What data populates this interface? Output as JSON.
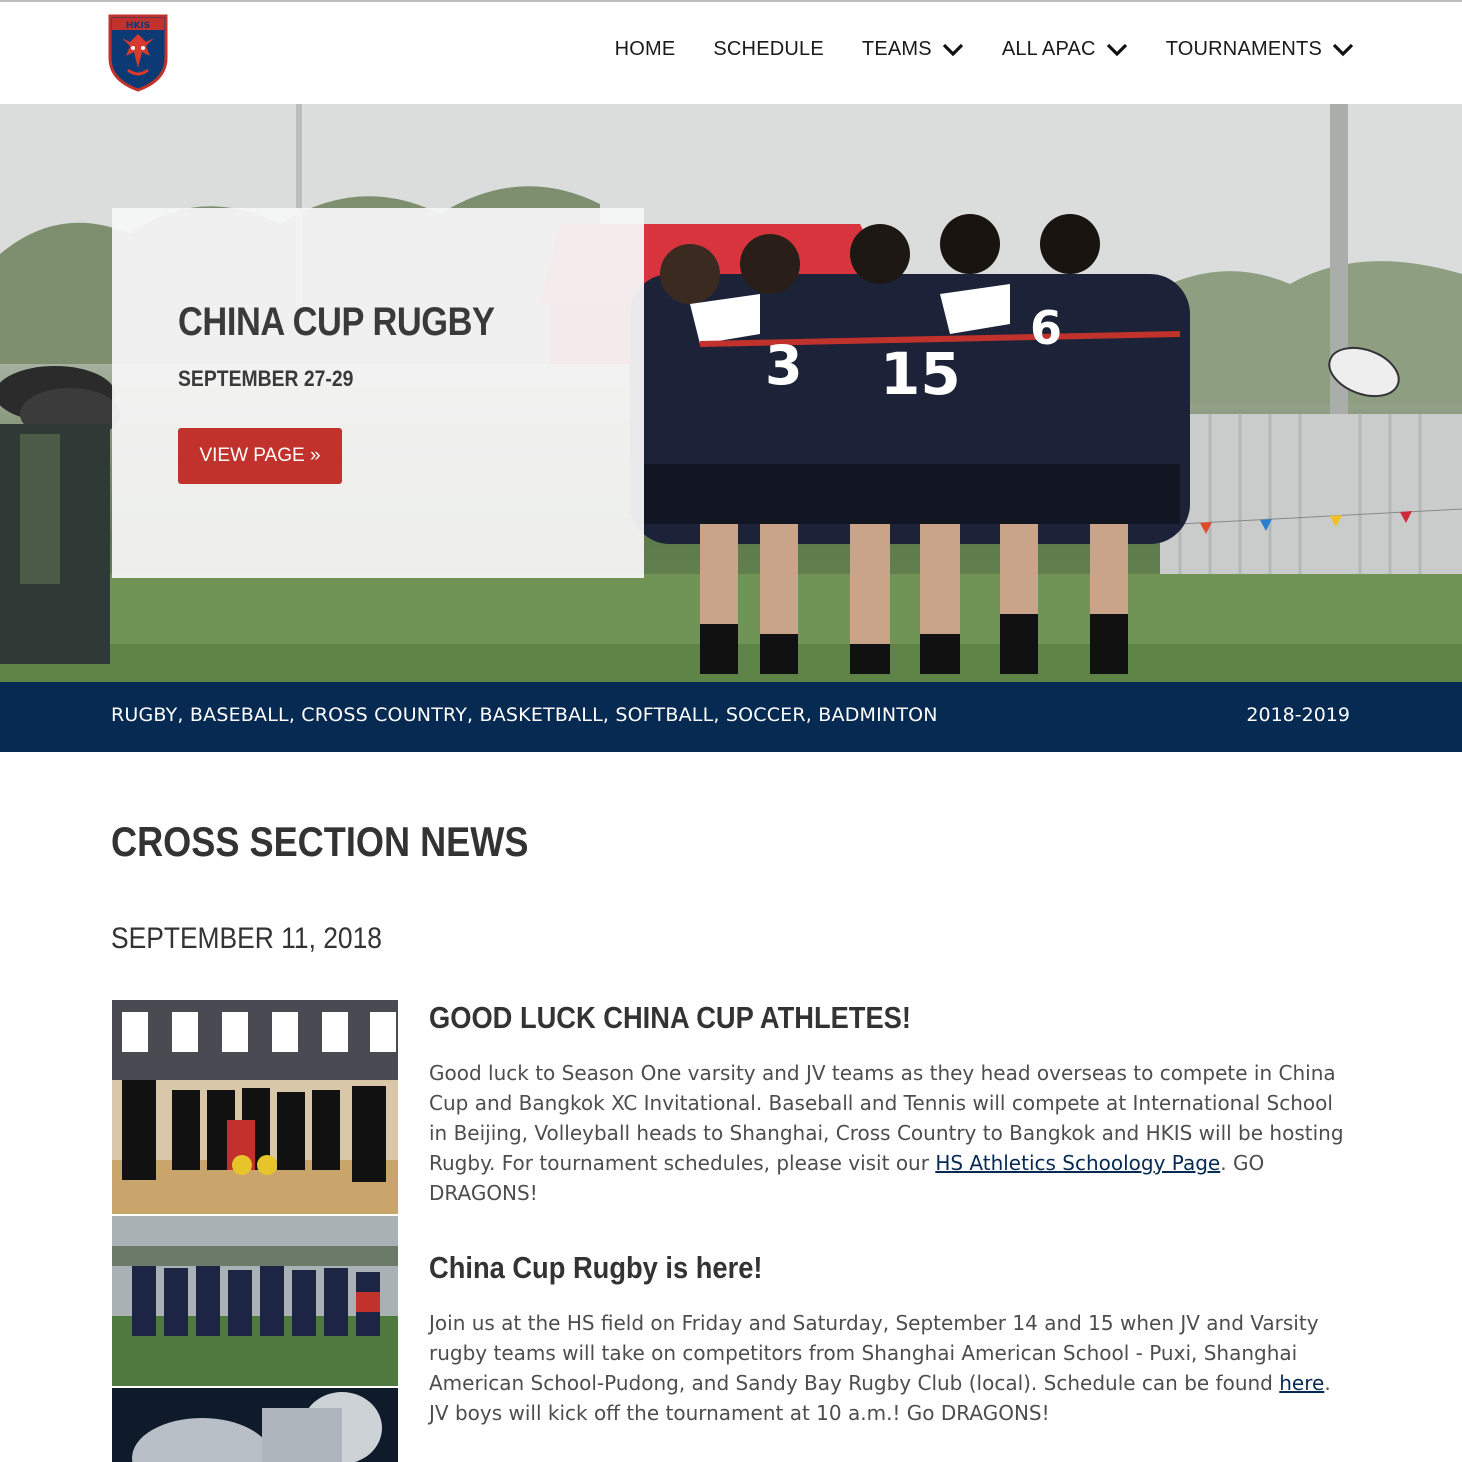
{
  "header": {
    "logo_alt": "HKIS",
    "nav": [
      {
        "label": "HOME"
      },
      {
        "label": "SCHEDULE"
      },
      {
        "label": "TEAMS"
      },
      {
        "label": "ALL APAC"
      },
      {
        "label": "TOURNAMENTS"
      }
    ]
  },
  "hero": {
    "title": "CHINA CUP RUGBY",
    "date": "SEPTEMBER 27-29",
    "button_label": "VIEW PAGE »"
  },
  "strip": {
    "sports": "RUGBY, BASEBALL, CROSS COUNTRY, BASKETBALL, SOFTBALL, SOCCER, BADMINTON",
    "season": "2018-2019"
  },
  "news": {
    "heading": "CROSS SECTION NEWS",
    "date": "SEPTEMBER 11, 2018",
    "articles": [
      {
        "title": "GOOD LUCK CHINA CUP ATHLETES!",
        "body_before": "Good luck to Season One varsity and JV teams as they head overseas to compete in China Cup and Bangkok XC Invitational. Baseball and Tennis will compete at International School in Beijing, Volleyball heads to Shanghai, Cross Country to Bangkok and HKIS will be hosting Rugby. For tournament schedules, please visit our ",
        "link": "HS Athletics Schoology Page",
        "body_after": ". GO DRAGONS!"
      },
      {
        "title": "China Cup Rugby is here!",
        "body_before": "Join us at the HS field on Friday and Saturday, September 14 and 15 when JV and Varsity rugby teams will take on competitors from Shanghai American School - Puxi, Shanghai American School-Pudong, and Sandy Bay Rugby Club (local). Schedule can be found ",
        "link": "here",
        "body_after": ". JV boys will kick off the tournament at 10 a.m.! Go DRAGONS!"
      }
    ]
  },
  "colors": {
    "brand_red": "#c0322b",
    "navy": "#062a52"
  }
}
